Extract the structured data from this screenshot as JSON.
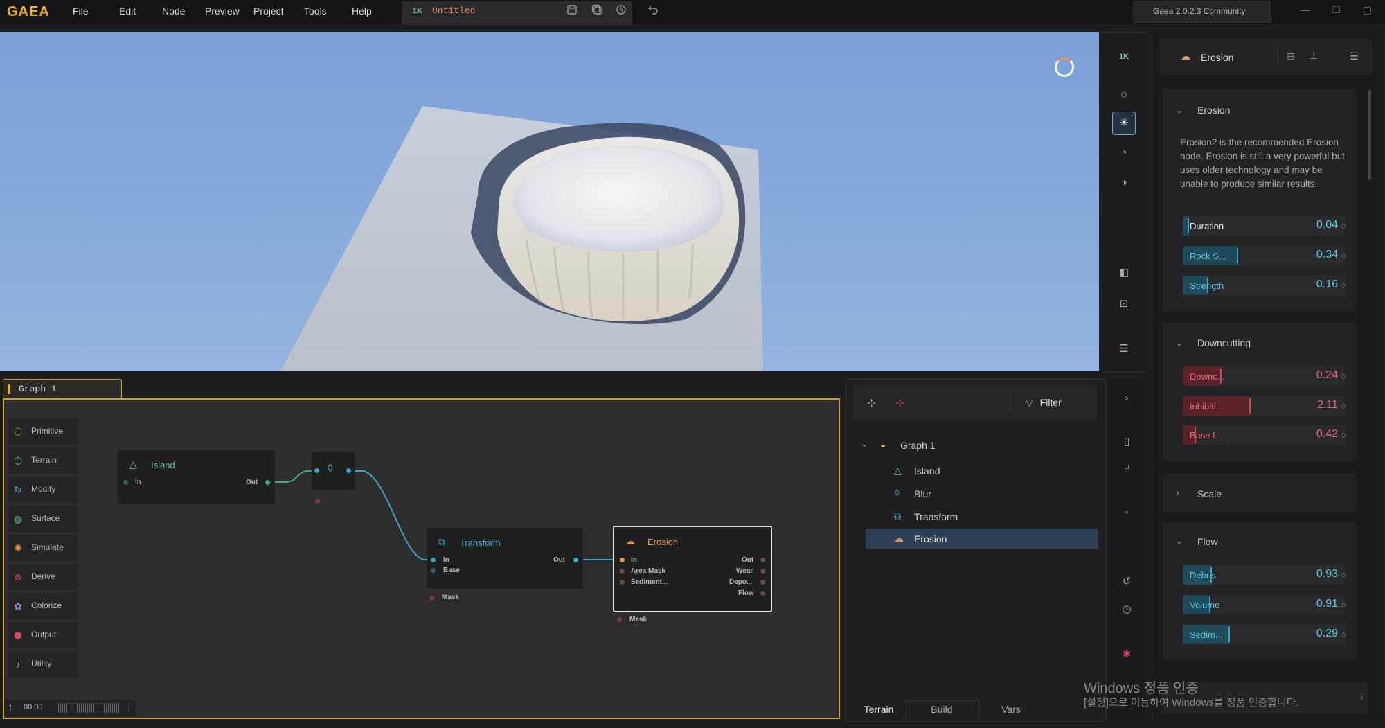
{
  "app": {
    "logo": "GAEA",
    "menu": [
      "File",
      "Edit",
      "Node",
      "Preview",
      "Project",
      "Tools",
      "Help"
    ],
    "resolution": "1K",
    "document_title": "Untitled",
    "version": "Gaea 2.0.2.3 Community"
  },
  "viewport": {
    "resolution_badge": "1K"
  },
  "graph": {
    "tab_label": "Graph 1",
    "library": [
      "Primitive",
      "Terrain",
      "Modify",
      "Surface",
      "Simulate",
      "Derive",
      "Colorize",
      "Output",
      "Utility"
    ],
    "library_colors": [
      "#8fbf4f",
      "#6cc0a0",
      "#5ba6d0",
      "#7ab8a8",
      "#e09a55",
      "#d0507a",
      "#a083d8",
      "#d04a66",
      "#bbbbbb"
    ],
    "nodes": {
      "island": {
        "title": "Island",
        "in": "In",
        "out": "Out"
      },
      "transform": {
        "title": "Transform",
        "in": "In",
        "base": "Base",
        "out": "Out",
        "mask": "Mask"
      },
      "erosion": {
        "title": "Erosion",
        "in": "In",
        "area_mask": "Area Mask",
        "sediment": "Sediment...",
        "out": "Out",
        "wear": "Wear",
        "deposits": "Depo...",
        "flow": "Flow",
        "mask": "Mask"
      }
    },
    "timeline": "00:00"
  },
  "outline": {
    "filter_label": "Filter",
    "root": "Graph 1",
    "items": [
      "Island",
      "Blur",
      "Transform",
      "Erosion"
    ],
    "selected": "Erosion",
    "tabs": [
      "Terrain",
      "Build",
      "Vars"
    ]
  },
  "properties": {
    "node_name": "Erosion",
    "sections": {
      "erosion": {
        "title": "Erosion",
        "description": "Erosion2 is the recommended Erosion node. Erosion is still a very powerful but uses older technology and may be unable to produce similar results.",
        "params": [
          {
            "name": "Duration",
            "value": "0.04",
            "level": 0.04
          },
          {
            "name": "Rock S...",
            "value": "0.34",
            "level": 0.34
          },
          {
            "name": "Strength",
            "value": "0.16",
            "level": 0.16
          }
        ]
      },
      "downcutting": {
        "title": "Downcutting",
        "params": [
          {
            "name": "Downc...",
            "value": "0.24",
            "level": 0.24
          },
          {
            "name": "Inhibiti...",
            "value": "2.11",
            "level": 0.42
          },
          {
            "name": "Base L...",
            "value": "0.42",
            "level": 0.08
          }
        ]
      },
      "scale": {
        "title": "Scale"
      },
      "flow": {
        "title": "Flow",
        "params": [
          {
            "name": "Debris",
            "value": "0.93",
            "level": 0.18
          },
          {
            "name": "Volume",
            "value": "0.91",
            "level": 0.17
          },
          {
            "name": "Sedim...",
            "value": "0.29",
            "level": 0.29
          }
        ]
      }
    }
  },
  "colors": {
    "accent": "#f0b400",
    "teal": "#3aa6c4",
    "red": "#d0475c",
    "selection": "#2c3e54"
  },
  "watermark": {
    "line1": "Windows 정품 인증",
    "line2": "[설정]으로 이동하여 Windows를 정품 인증합니다."
  }
}
